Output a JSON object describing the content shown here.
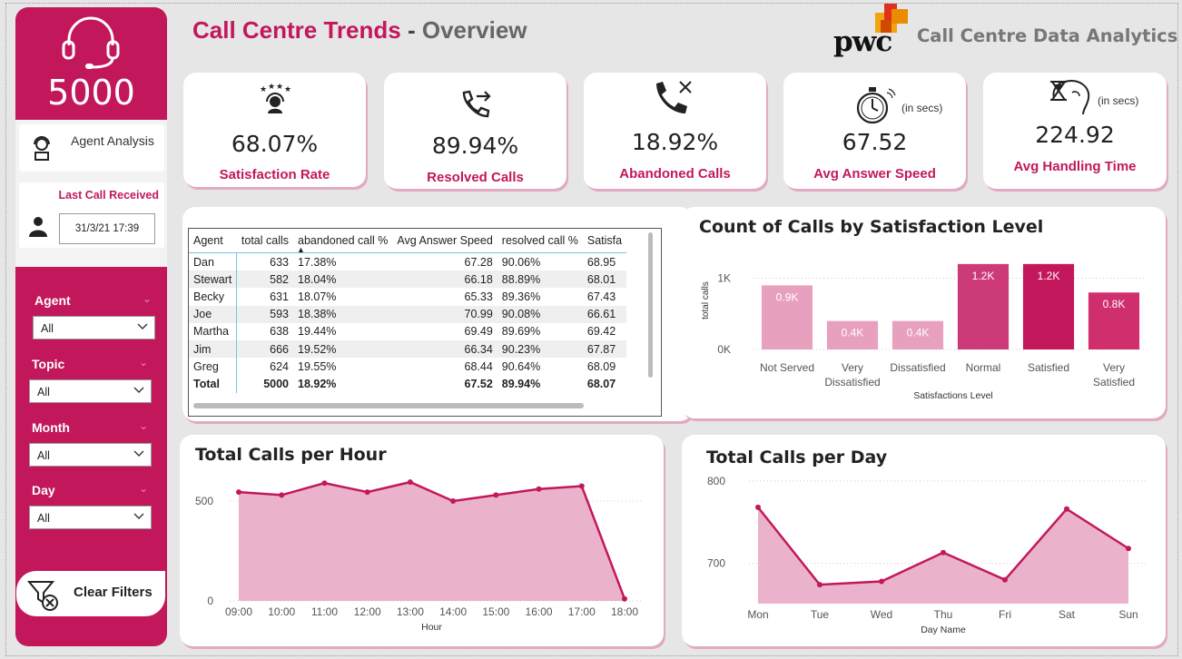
{
  "header": {
    "title_part1": "Call Centre Trends",
    "title_sep": "-",
    "title_part2": "Overview",
    "brand": "pwc",
    "subtitle": "Call Centre Data Analytics"
  },
  "sidebar": {
    "total_calls": "5000",
    "agent_analysis_label": "Agent Analysis",
    "last_call_label": "Last Call Received",
    "last_call_value": "31/3/21 17:39",
    "filters": [
      {
        "label": "Agent",
        "value": "All"
      },
      {
        "label": "Topic",
        "value": "All"
      },
      {
        "label": "Month",
        "value": "All"
      },
      {
        "label": "Day",
        "value": "All"
      }
    ],
    "clear_filters": "Clear Filters"
  },
  "kpis": [
    {
      "value": "68.07%",
      "label": "Satisfaction Rate",
      "icon": "satisfaction-icon",
      "unit": ""
    },
    {
      "value": "89.94%",
      "label": "Resolved Calls",
      "icon": "phone-forward-icon",
      "unit": ""
    },
    {
      "value": "18.92%",
      "label": "Abandoned Calls",
      "icon": "phone-cancel-icon",
      "unit": ""
    },
    {
      "value": "67.52",
      "label": "Avg Answer Speed",
      "icon": "stopwatch-icon",
      "unit": "(in secs)"
    },
    {
      "value": "224.92",
      "label": "Avg Handling Time",
      "icon": "hourglass-head-icon",
      "unit": "(in secs)"
    }
  ],
  "agent_table": {
    "columns": [
      "Agent",
      "total calls",
      "abandoned call %",
      "Avg Answer Speed",
      "resolved call %",
      "Satisfa"
    ],
    "rows": [
      [
        "Dan",
        "633",
        "17.38%",
        "67.28",
        "90.06%",
        "68.95"
      ],
      [
        "Stewart",
        "582",
        "18.04%",
        "66.18",
        "88.89%",
        "68.01"
      ],
      [
        "Becky",
        "631",
        "18.07%",
        "65.33",
        "89.36%",
        "67.43"
      ],
      [
        "Joe",
        "593",
        "18.38%",
        "70.99",
        "90.08%",
        "66.61"
      ],
      [
        "Martha",
        "638",
        "19.44%",
        "69.49",
        "89.69%",
        "69.42"
      ],
      [
        "Jim",
        "666",
        "19.52%",
        "66.34",
        "90.23%",
        "67.87"
      ],
      [
        "Greg",
        "624",
        "19.55%",
        "68.44",
        "90.64%",
        "68.09"
      ]
    ],
    "total": [
      "Total",
      "5000",
      "18.92%",
      "67.52",
      "89.94%",
      "68.07"
    ]
  },
  "charts": {
    "satisfaction": {
      "type": "bar",
      "title": "Count of Calls by Satisfaction Level",
      "xlabel": "Satisfactions Level",
      "ylabel": "total calls",
      "categories": [
        [
          "Not Served"
        ],
        [
          "Very",
          "Dissatisfied"
        ],
        [
          "Dissatisfied"
        ],
        [
          "Normal"
        ],
        [
          "Satisfied"
        ],
        [
          "Very",
          "Satisfied"
        ]
      ],
      "values": [
        900,
        400,
        400,
        1200,
        1200,
        800
      ],
      "data_labels": [
        "0.9K",
        "0.4K",
        "0.4K",
        "1.2K",
        "1.2K",
        "0.8K"
      ],
      "colors": [
        "#e8a0bf",
        "#e8a0bf",
        "#e8a0bf",
        "#cd3a78",
        "#c2185b",
        "#d02f6e"
      ],
      "yticks": [
        {
          "v": 0,
          "t": "0K"
        },
        {
          "v": 1000,
          "t": "1K"
        }
      ],
      "ylim": [
        0,
        1300
      ]
    },
    "hour": {
      "type": "area",
      "title": "Total Calls per Hour",
      "xlabel": "Hour",
      "categories": [
        "09:00",
        "10:00",
        "11:00",
        "12:00",
        "13:00",
        "14:00",
        "15:00",
        "16:00",
        "17:00",
        "18:00"
      ],
      "values": [
        545,
        530,
        590,
        545,
        595,
        500,
        530,
        560,
        575,
        10
      ],
      "yticks": [
        {
          "v": 0,
          "t": "0"
        },
        {
          "v": 500,
          "t": "500"
        }
      ],
      "ylim": [
        0,
        650
      ]
    },
    "day": {
      "type": "area",
      "title": "Total Calls per Day",
      "xlabel": "Day Name",
      "categories": [
        "Mon",
        "Tue",
        "Wed",
        "Thu",
        "Fri",
        "Sat",
        "Sun"
      ],
      "values": [
        768,
        674,
        678,
        713,
        680,
        766,
        718
      ],
      "yticks": [
        {
          "v": 700,
          "t": "700"
        },
        {
          "v": 800,
          "t": "800"
        }
      ],
      "ylim": [
        651,
        812
      ]
    }
  },
  "colors": {
    "accent": "#c2185b",
    "area_fill": "#eab3cb",
    "title_grey": "#666666"
  }
}
